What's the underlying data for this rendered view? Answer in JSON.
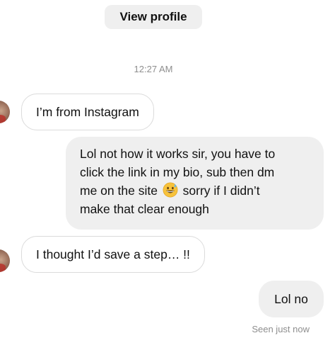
{
  "header": {
    "view_profile_label": "View profile"
  },
  "thread": {
    "timestamp": "12:27 AM",
    "messages": [
      {
        "direction": "received",
        "text": "I’m from Instagram"
      },
      {
        "direction": "sent",
        "lines": [
          "Lol not how it works sir, you have to",
          "click the link in my bio, sub then dm",
          "me on the site",
          "sorry if I didn’t",
          "make that clear enough"
        ],
        "emoji": "grinning-face-with-sweat-icon"
      },
      {
        "direction": "received",
        "text": "I thought I’d save a step… !!"
      },
      {
        "direction": "sent",
        "text": "Lol no"
      }
    ],
    "read_receipt": "Seen just now"
  },
  "colors": {
    "sent_bubble": "#efefef",
    "received_border": "#dbdbdb",
    "muted_text": "#8e8e8e",
    "button_bg": "#efefef"
  }
}
